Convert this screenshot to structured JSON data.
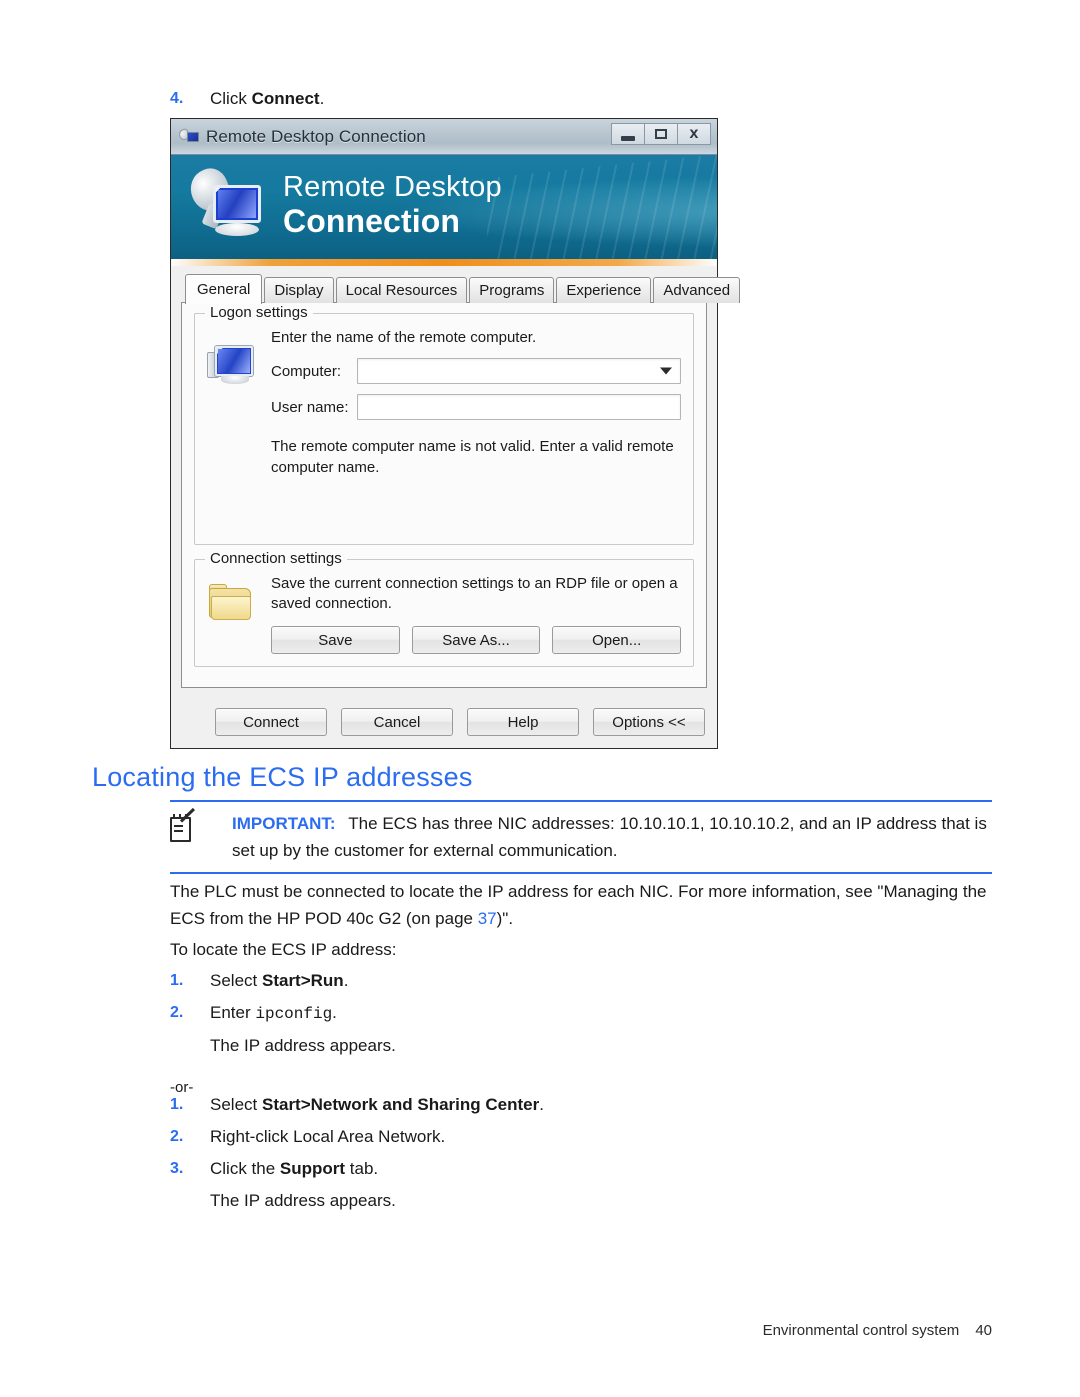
{
  "document": {
    "top_step": {
      "number": "4.",
      "text_before": "Click ",
      "bold": "Connect",
      "text_after": "."
    },
    "section_heading": "Locating the ECS IP addresses",
    "note": {
      "label": "IMPORTANT:",
      "text": "The ECS has three NIC addresses: 10.10.10.1, 10.10.10.2, and an IP address that is set up by the customer for external communication.",
      "icon": "notepad-pencil-icon",
      "rule_color": "#2b6cf0"
    },
    "paragraphs": [
      {
        "part1": "The PLC must be connected to locate the IP address for each NIC. For more information, see \"Managing the ECS from the HP POD 40c G2 (on page ",
        "link": "37",
        "part2": ")\"."
      },
      {
        "part1": "To locate the ECS IP address:"
      }
    ],
    "steps_group_1": [
      {
        "num": "1.",
        "pre": "Select ",
        "bold": "Start>Run",
        "post": "."
      },
      {
        "num": "2.",
        "pre": "Enter ",
        "mono": "ipconfig",
        "post": "."
      }
    ],
    "result_1": "The IP address appears.",
    "or_divider": "-or-",
    "steps_group_2": [
      {
        "num": "1.",
        "pre": "Select ",
        "bold": "Start>Network and Sharing Center",
        "post": "."
      },
      {
        "num": "2.",
        "pre": "Right-click Local Area Network.",
        "bold": "",
        "post": ""
      },
      {
        "num": "3.",
        "pre": "Click the ",
        "bold": "Support",
        "post": " tab."
      }
    ],
    "result_2": "The IP address appears.",
    "footer": {
      "label": "Environmental control system",
      "page_number": "40"
    },
    "heading_color": "#2b6cf0"
  },
  "rdp_dialog": {
    "titlebar": {
      "title": "Remote Desktop Connection",
      "icon": "remote-desktop-icon",
      "minimize": "minimize-icon",
      "maximize": "maximize-icon",
      "close": "close-icon"
    },
    "banner": {
      "line1": "Remote Desktop",
      "line2": "Connection",
      "icon": "remote-desktop-banner-icon",
      "bg_color": "#14769c",
      "accent_color": "#ef8f1c"
    },
    "tabs": [
      {
        "label": "General",
        "active": true
      },
      {
        "label": "Display",
        "active": false
      },
      {
        "label": "Local Resources",
        "active": false
      },
      {
        "label": "Programs",
        "active": false
      },
      {
        "label": "Experience",
        "active": false
      },
      {
        "label": "Advanced",
        "active": false
      }
    ],
    "logon_group": {
      "title": "Logon settings",
      "icon": "computer-monitor-icon",
      "help": "Enter the name of the remote computer.",
      "computer_label": "Computer:",
      "computer_value": "",
      "username_label": "User name:",
      "username_value": "",
      "error": "The remote computer name is not valid. Enter a valid remote computer name."
    },
    "connection_group": {
      "title": "Connection settings",
      "icon": "folder-icon",
      "help": "Save the current connection settings to an RDP file or open a saved connection.",
      "buttons": [
        "Save",
        "Save As...",
        "Open..."
      ]
    },
    "footer_buttons": [
      "Connect",
      "Cancel",
      "Help",
      "Options <<"
    ]
  }
}
